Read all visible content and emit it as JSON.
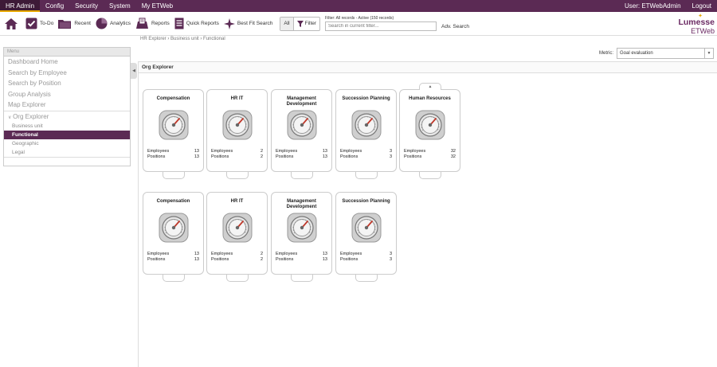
{
  "topmenu": {
    "items": [
      "HR Admin",
      "Config",
      "Security",
      "System",
      "My ETWeb"
    ],
    "user": "User: ETWebAdmin",
    "logout": "Logout"
  },
  "toolbar": {
    "todo": "To-Do",
    "recent": "Recent",
    "analytics": "Analytics",
    "reports": "Reports",
    "quick_reports": "Quick Reports",
    "best_fit": "Best Fit Search",
    "all": "All",
    "filter": "Filter",
    "filter_info": "Filter: All records - Active (150 records)",
    "search_placeholder": "Search in current filter...",
    "adv_search": "Adv. Search"
  },
  "logo": {
    "line1": "Lumesse",
    "line2": "ETWeb"
  },
  "breadcrumb": "HR Explorer › Business unit › Functional",
  "metric": {
    "label": "Metric:",
    "value": "Goal evaluation"
  },
  "sidebar": {
    "header": "Menu",
    "items": [
      "Dashboard Home",
      "Search by Employee",
      "Search by Position",
      "Group Analysis",
      "Map Explorer"
    ],
    "group": "Org Explorer",
    "subitems": [
      "Business unit",
      "Functional",
      "Geographic",
      "Legal"
    ],
    "selected": "Functional"
  },
  "panel_title": "Org Explorer",
  "labels": {
    "employees": "Employees",
    "positions": "Positions"
  },
  "row1": [
    {
      "title": "Compensation",
      "employees": "13",
      "positions": "13"
    },
    {
      "title": "HR IT",
      "employees": "2",
      "positions": "2"
    },
    {
      "title": "Management Development",
      "employees": "13",
      "positions": "13"
    },
    {
      "title": "Succession Planning",
      "employees": "3",
      "positions": "3"
    },
    {
      "title": "Human Resources",
      "employees": "32",
      "positions": "32"
    }
  ],
  "row2": [
    {
      "title": "Compensation",
      "employees": "13",
      "positions": "13"
    },
    {
      "title": "HR IT",
      "employees": "2",
      "positions": "2"
    },
    {
      "title": "Management Development",
      "employees": "13",
      "positions": "13"
    },
    {
      "title": "Succession Planning",
      "employees": "3",
      "positions": "3"
    }
  ],
  "colors": {
    "brand": "#5b2a54",
    "accent": "#e8a800",
    "gauge_needle": "#c0392b"
  }
}
